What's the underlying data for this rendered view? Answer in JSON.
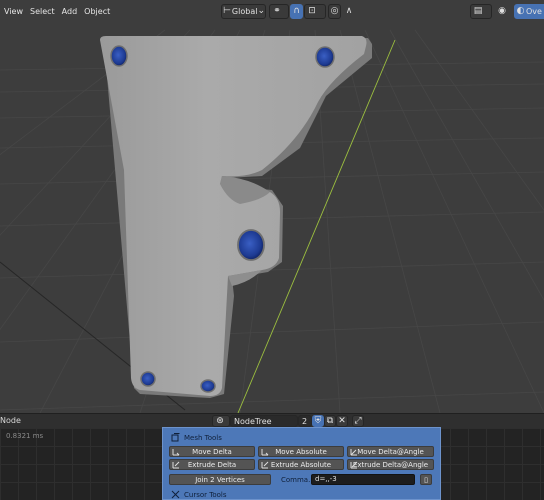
{
  "viewport": {
    "menu": [
      "View",
      "Select",
      "Add",
      "Object"
    ],
    "orientation_label": "Global",
    "overlay_label": "Ove"
  },
  "node_editor": {
    "editor_label": "Node",
    "tree_name": "NodeTree",
    "user_count": "2",
    "timing": "0.8321 ms"
  },
  "mesh_tools": {
    "title": "Mesh Tools",
    "buttons": {
      "move_delta": "Move Delta",
      "move_absolute": "Move Absolute",
      "move_delta_angle": "Move Delta@Angle",
      "extrude_delta": "Extrude Delta",
      "extrude_absolute": "Extrude Absolute",
      "extrude_delta_angle": "Extrude Delta@Angle",
      "join_vertices": "Join 2 Vertices"
    },
    "command_label": "Comma...",
    "command_value": "d=,,-3",
    "cursor_tools_label": "Cursor Tools"
  },
  "colors": {
    "viewport_bg": "#3d3d3d",
    "grid_line": "#4a4a4a",
    "mesh_face": "#a6a6a6",
    "hole_fill": "#1f3f96",
    "y_axis": "#9cbf3f",
    "panel_bg": "#4d78b8",
    "accent": "#4772b3"
  }
}
